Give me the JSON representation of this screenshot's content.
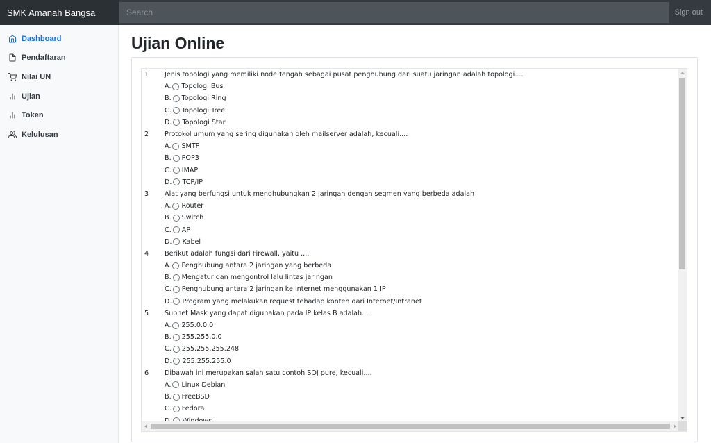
{
  "navbar": {
    "brand": "SMK Amanah Bangsa",
    "search_placeholder": "Search",
    "signout_label": "Sign out"
  },
  "sidebar": {
    "items": [
      {
        "label": "Dashboard",
        "icon": "home-icon",
        "active": true
      },
      {
        "label": "Pendaftaran",
        "icon": "file-icon",
        "active": false
      },
      {
        "label": "Nilai UN",
        "icon": "cart-icon",
        "active": false
      },
      {
        "label": "Ujian",
        "icon": "bar-chart-icon",
        "active": false
      },
      {
        "label": "Token",
        "icon": "bar-chart-icon",
        "active": false
      },
      {
        "label": "Kelulusan",
        "icon": "users-icon",
        "active": false
      }
    ]
  },
  "main": {
    "title": "Ujian Online"
  },
  "colors": {
    "navbar": "#343a40",
    "brand_bg": "#2b3035",
    "accent": "#0d6efd",
    "sidebar_bg": "#f8f9fa"
  },
  "questions": [
    {
      "number": "1",
      "text": "Jenis topologi yang memiliki node tengah sebagai pusat penghubung dari suatu jaringan adalah topologi....",
      "options": [
        {
          "letter": "A.",
          "text": "Topologi Bus"
        },
        {
          "letter": "B.",
          "text": "Topologi Ring"
        },
        {
          "letter": "C.",
          "text": "Topologi Tree"
        },
        {
          "letter": "D.",
          "text": "Topologi Star"
        }
      ]
    },
    {
      "number": "2",
      "text": "Protokol umum yang sering digunakan oleh mailserver adalah, kecuali....",
      "options": [
        {
          "letter": "A.",
          "text": "SMTP"
        },
        {
          "letter": "B.",
          "text": "POP3"
        },
        {
          "letter": "C.",
          "text": "IMAP"
        },
        {
          "letter": "D.",
          "text": "TCP/IP"
        }
      ]
    },
    {
      "number": "3",
      "text": "Alat yang berfungsi untuk menghubungkan 2 jaringan dengan segmen yang berbeda adalah",
      "options": [
        {
          "letter": "A.",
          "text": "Router"
        },
        {
          "letter": "B.",
          "text": "Switch"
        },
        {
          "letter": "C.",
          "text": "AP"
        },
        {
          "letter": "D.",
          "text": "Kabel"
        }
      ]
    },
    {
      "number": "4",
      "text": "Berikut adalah fungsi dari Firewall, yaitu ....",
      "options": [
        {
          "letter": "A.",
          "text": "Penghubung antara 2 jaringan yang berbeda"
        },
        {
          "letter": "B.",
          "text": "Mengatur dan mengontrol lalu lintas jaringan"
        },
        {
          "letter": "C.",
          "text": "Penghubung antara 2 jaringan ke internet menggunakan 1 IP"
        },
        {
          "letter": "D.",
          "text": "Program yang melakukan request tehadap konten dari Internet/Intranet"
        }
      ]
    },
    {
      "number": "5",
      "text": "Subnet Mask yang dapat digunakan pada IP kelas B adalah....",
      "options": [
        {
          "letter": "A.",
          "text": "255.0.0.0"
        },
        {
          "letter": "B.",
          "text": "255.255.0.0"
        },
        {
          "letter": "C.",
          "text": "255.255.255.248"
        },
        {
          "letter": "D.",
          "text": "255.255.255.0"
        }
      ]
    },
    {
      "number": "6",
      "text": "Dibawah ini merupakan salah satu contoh SOJ pure, kecuali....",
      "options": [
        {
          "letter": "A.",
          "text": "Linux Debian"
        },
        {
          "letter": "B.",
          "text": "FreeBSD"
        },
        {
          "letter": "C.",
          "text": "Fedora"
        },
        {
          "letter": "D.",
          "text": "Windows"
        }
      ]
    }
  ]
}
